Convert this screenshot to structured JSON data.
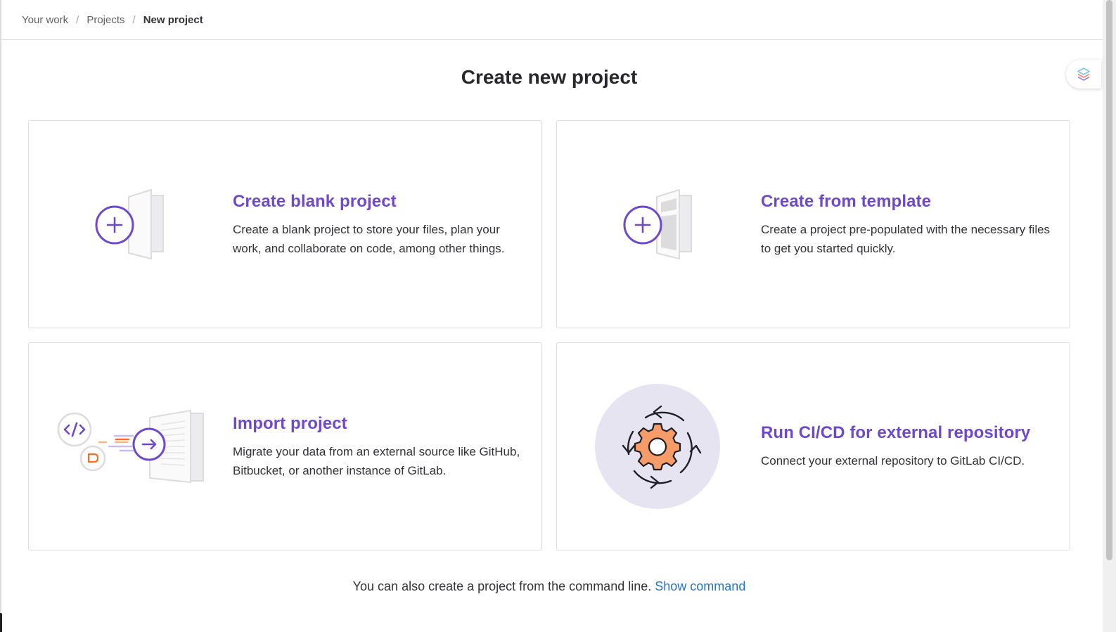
{
  "breadcrumb": {
    "items": [
      "Your work",
      "Projects"
    ],
    "current": "New project",
    "separator": "/"
  },
  "page": {
    "title": "Create new project"
  },
  "cards": {
    "blank": {
      "title": "Create blank project",
      "description": "Create a blank project to store your files, plan your work, and collaborate on code, among other things.",
      "icon": "blank-project-illustration"
    },
    "template": {
      "title": "Create from template",
      "description": "Create a project pre-populated with the necessary files to get you started quickly.",
      "icon": "template-project-illustration"
    },
    "import": {
      "title": "Import project",
      "description": "Migrate your data from an external source like GitHub, Bitbucket, or another instance of GitLab.",
      "icon": "import-project-illustration"
    },
    "cicd": {
      "title": "Run CI/CD for external repository",
      "description": "Connect your external repository to GitLab CI/CD.",
      "icon": "cicd-gear-illustration"
    }
  },
  "footer": {
    "text": "You can also create a project from the command line.",
    "link": "Show command"
  },
  "colors": {
    "accent_purple": "#6e49cb",
    "link_blue": "#1f75cb",
    "gear_orange": "#f59c69",
    "circle_bg": "#e7e4f2"
  }
}
